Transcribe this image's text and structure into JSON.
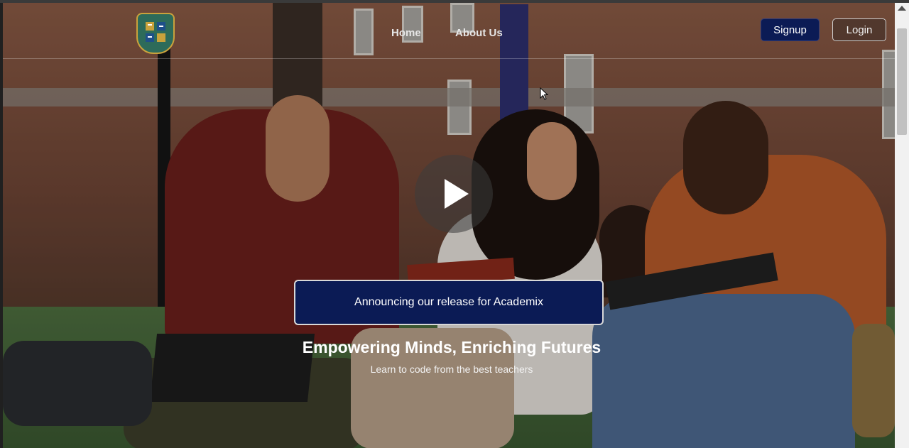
{
  "header": {
    "logo_icon": "academix-shield-logo-icon",
    "nav": [
      {
        "label": "Home"
      },
      {
        "label": "About Us"
      }
    ],
    "signup_label": "Signup",
    "login_label": "Login"
  },
  "hero": {
    "play_icon": "play-icon",
    "announcement": "Announcing our release for Academix",
    "headline": "Empowering Minds, Enriching Futures",
    "subheadline": "Learn to code from the best teachers"
  },
  "colors": {
    "primary_navy": "#0b1b55",
    "text_white": "#ffffff",
    "shield_green": "#2d6b5a",
    "shield_gold": "#c9a23c"
  }
}
